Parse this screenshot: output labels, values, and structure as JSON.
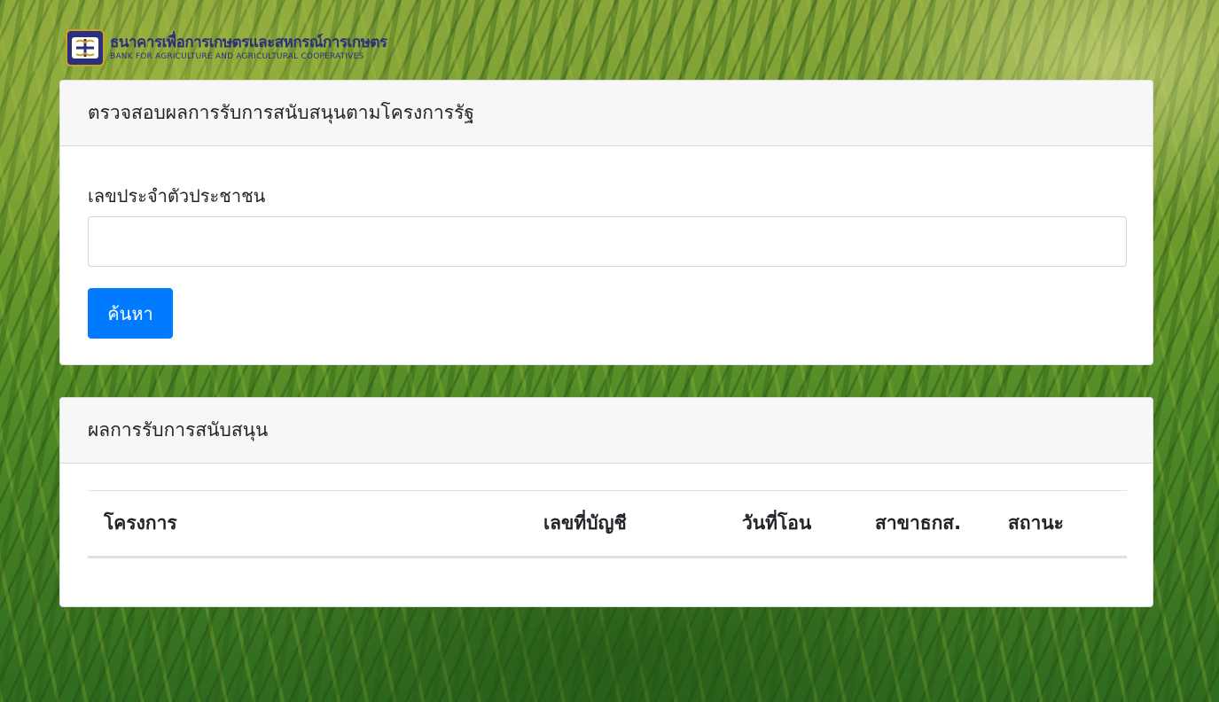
{
  "logo": {
    "thai_name": "ธนาคารเพื่อการเกษตรและสหกรณ์การเกษตร",
    "english_name": "BANK FOR AGRICULTURE AND AGRICULTURAL COOPERATIVES"
  },
  "search_card": {
    "title": "ตรวจสอบผลการรับการสนับสนุนตามโครงการรัฐ",
    "id_label": "เลขประจำตัวประชาชน",
    "id_value": "",
    "search_button": "ค้นหา"
  },
  "results_card": {
    "title": "ผลการรับการสนับสนุน",
    "columns": [
      "โครงการ",
      "เลขที่บัญชี",
      "วันที่โอน",
      "สาขาธกส.",
      "สถานะ"
    ],
    "rows": []
  },
  "colors": {
    "primary_button": "#007bff",
    "logo_blue": "#2c2f7a",
    "logo_gold": "#c9a227"
  }
}
